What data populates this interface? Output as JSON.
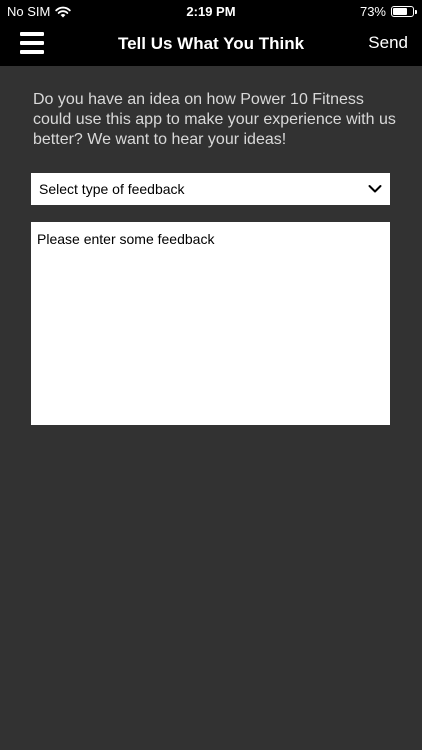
{
  "status_bar": {
    "carrier": "No SIM",
    "time": "2:19 PM",
    "battery": "73%"
  },
  "nav": {
    "title": "Tell Us What You Think",
    "send_label": "Send"
  },
  "intro_text": "Do you have an idea on how Power 10 Fitness could use this app to make your experience with us better? We want to hear your ideas!",
  "feedback_type": {
    "selected": "Select type of feedback"
  },
  "feedback_input": {
    "placeholder": "Please enter some feedback",
    "value": ""
  },
  "colors": {
    "background": "#323232",
    "bar": "#000000",
    "text_light": "#d9d9d9"
  }
}
